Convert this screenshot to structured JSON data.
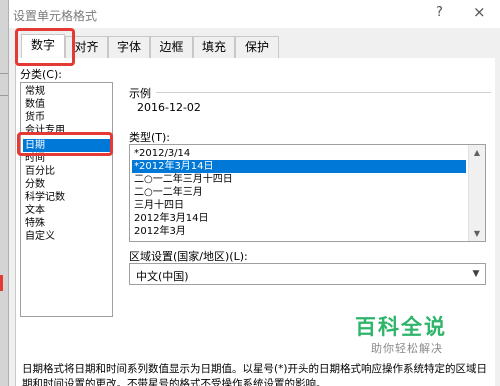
{
  "dialog": {
    "title": "设置单元格格式",
    "help": "?",
    "close": "×"
  },
  "tabs": [
    "数字",
    "对齐",
    "字体",
    "边框",
    "填充",
    "保护"
  ],
  "category": {
    "label": "分类(C):",
    "items": [
      "常规",
      "数值",
      "货币",
      "会计专用",
      "日期",
      "时间",
      "百分比",
      "分数",
      "科学记数",
      "文本",
      "特殊",
      "自定义"
    ],
    "selected": "日期"
  },
  "sample": {
    "label": "示例",
    "value": "2016-12-02"
  },
  "type": {
    "label": "类型(T):",
    "items": [
      "*2012/3/14",
      "*2012年3月14日",
      "二○一二年三月十四日",
      "二○一二年三月",
      "三月十四日",
      "2012年3月14日",
      "2012年3月"
    ],
    "selected": "*2012年3月14日"
  },
  "locale": {
    "label": "区域设置(国家/地区)(L):",
    "value": "中文(中国)"
  },
  "watermark": {
    "title": "百科全说",
    "subtitle": "助你轻松解决"
  },
  "description": "日期格式将日期和时间系列数值显示为日期值。以星号(*)开头的日期格式响应操作系统特定的区域日期和时间设置的更改。不带星号的格式不受操作系统设置的影响。",
  "colors": {
    "selection": "#0078d7",
    "highlight": "#e53935",
    "watermark": "#2fb56a"
  }
}
